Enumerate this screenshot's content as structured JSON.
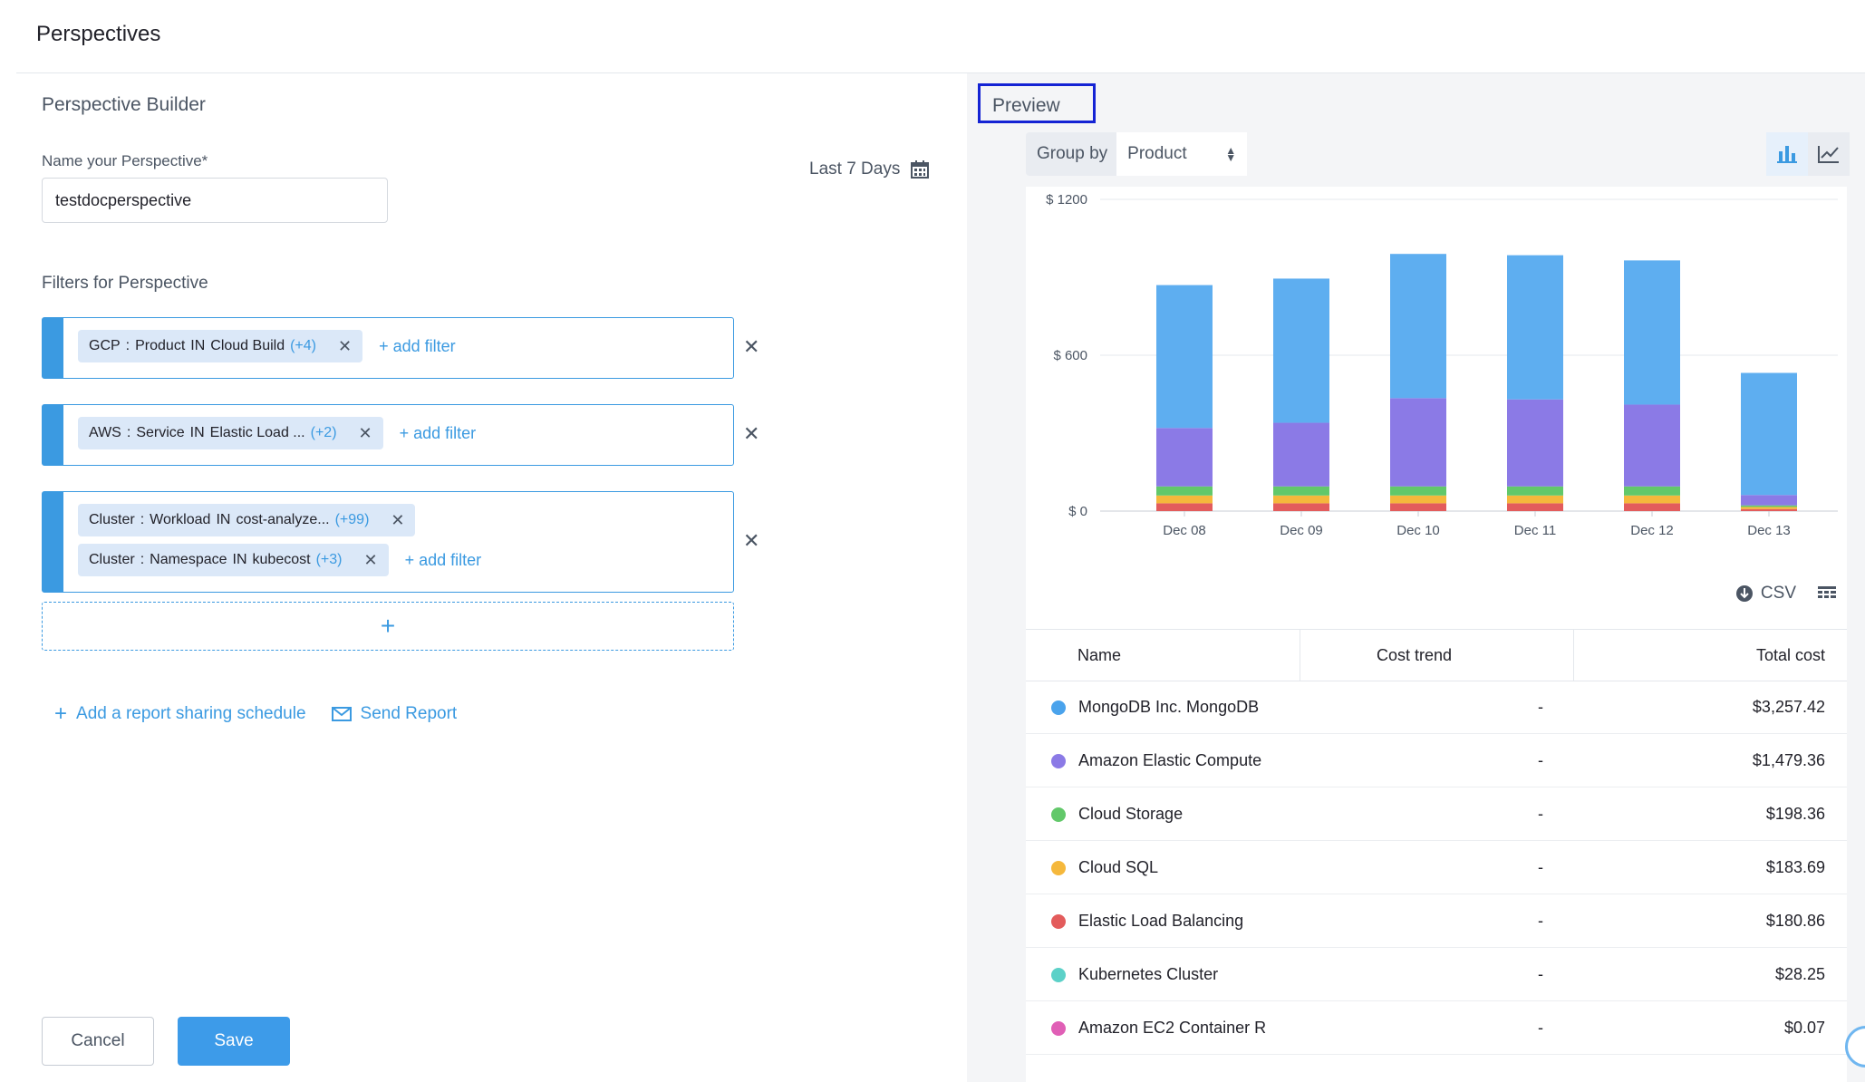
{
  "header": {
    "title": "Perspectives"
  },
  "builder": {
    "title": "Perspective Builder",
    "name_label": "Name your Perspective*",
    "name_value": "testdocperspective",
    "date_range": "Last 7 Days",
    "filters_label": "Filters for Perspective",
    "groups": [
      {
        "filters": [
          {
            "source": "GCP",
            "field": "Product",
            "op": "IN",
            "value": "Cloud Build",
            "more": "(+4)"
          }
        ],
        "add_filter": "+ add filter"
      },
      {
        "filters": [
          {
            "source": "AWS",
            "field": "Service",
            "op": "IN",
            "value": "Elastic Load ...",
            "more": "(+2)"
          }
        ],
        "add_filter": "+ add filter"
      },
      {
        "filters": [
          {
            "source": "Cluster",
            "field": "Workload",
            "op": "IN",
            "value": "cost-analyze...",
            "more": "(+99)"
          },
          {
            "source": "Cluster",
            "field": "Namespace",
            "op": "IN",
            "value": "kubecost",
            "more": "(+3)"
          }
        ],
        "add_filter": "+ add filter"
      }
    ],
    "add_group": "+",
    "schedule_link": "Add a report sharing schedule",
    "send_report": "Send Report",
    "cancel": "Cancel",
    "save": "Save"
  },
  "preview": {
    "title": "Preview",
    "group_by_label": "Group by",
    "group_by_value": "Product",
    "icons": {
      "bar": "bar-chart-icon",
      "line": "line-chart-icon",
      "csv": "download-icon",
      "columns": "columns-icon"
    },
    "csv_label": "CSV",
    "table": {
      "columns": [
        "Name",
        "Cost trend",
        "Total cost"
      ],
      "rows": [
        {
          "name": "MongoDB Inc. MongoDB",
          "trend": "-",
          "cost": "$3,257.42",
          "color": "#4aa3ec"
        },
        {
          "name": "Amazon Elastic Compute",
          "trend": "-",
          "cost": "$1,479.36",
          "color": "#8b7ae6"
        },
        {
          "name": "Cloud Storage",
          "trend": "-",
          "cost": "$198.36",
          "color": "#62c86a"
        },
        {
          "name": "Cloud SQL",
          "trend": "-",
          "cost": "$183.69",
          "color": "#f5b83c"
        },
        {
          "name": "Elastic Load Balancing",
          "trend": "-",
          "cost": "$180.86",
          "color": "#e35c5c"
        },
        {
          "name": "Kubernetes Cluster",
          "trend": "-",
          "cost": "$28.25",
          "color": "#5cd1c8"
        },
        {
          "name": "Amazon EC2 Container R",
          "trend": "-",
          "cost": "$0.07",
          "color": "#e05fb6"
        }
      ]
    }
  },
  "chart_data": {
    "type": "bar",
    "stacked": true,
    "categories": [
      "Dec 08",
      "Dec 09",
      "Dec 10",
      "Dec 11",
      "Dec 12",
      "Dec 13"
    ],
    "y_ticks": [
      "$ 0",
      "$ 600",
      "$ 1200"
    ],
    "ylim": [
      0,
      1200
    ],
    "series": [
      {
        "name": "Elastic Load Balancing",
        "color": "#e35c5c",
        "values": [
          30,
          30,
          30,
          30,
          30,
          8
        ]
      },
      {
        "name": "Cloud SQL",
        "color": "#f5b83c",
        "values": [
          30,
          30,
          30,
          30,
          30,
          8
        ]
      },
      {
        "name": "Cloud Storage",
        "color": "#62c86a",
        "values": [
          35,
          35,
          35,
          35,
          35,
          6
        ]
      },
      {
        "name": "Amazon Elastic Compute",
        "color": "#8b7ae6",
        "values": [
          225,
          245,
          340,
          335,
          315,
          40
        ]
      },
      {
        "name": "MongoDB Inc. MongoDB",
        "color": "#5eaef0",
        "values": [
          550,
          555,
          555,
          555,
          555,
          470
        ]
      }
    ]
  }
}
